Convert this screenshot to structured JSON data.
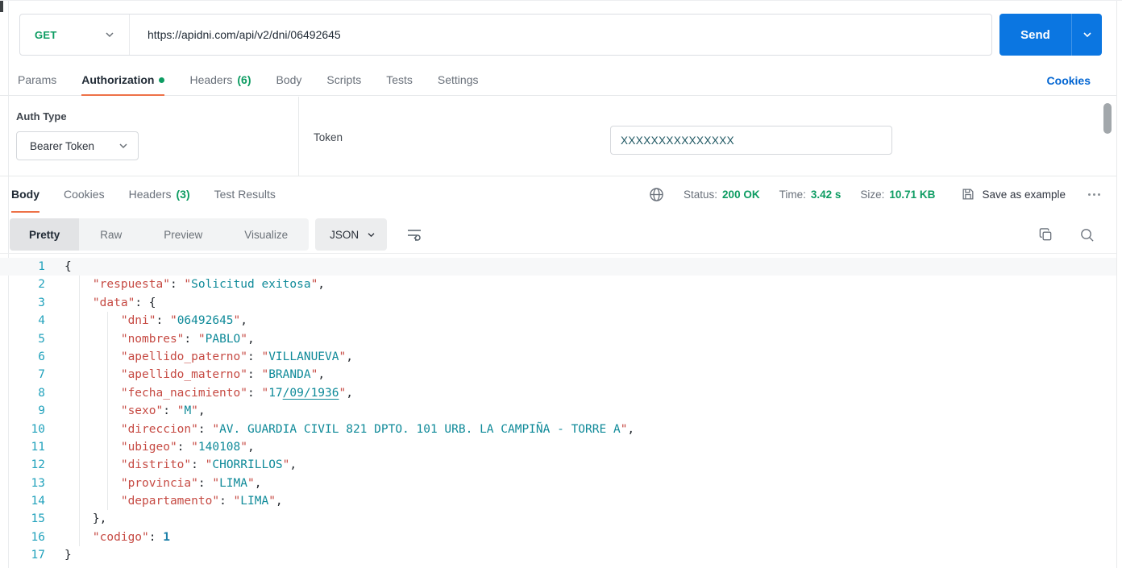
{
  "request": {
    "method": "GET",
    "url": "https://apidni.com/api/v2/dni/06492645",
    "send_label": "Send"
  },
  "request_tabs": {
    "items": [
      {
        "label": "Params"
      },
      {
        "label": "Authorization",
        "active": true,
        "dot": true
      },
      {
        "label": "Headers",
        "count": "(6)"
      },
      {
        "label": "Body"
      },
      {
        "label": "Scripts"
      },
      {
        "label": "Tests"
      },
      {
        "label": "Settings"
      }
    ],
    "cookies_link": "Cookies"
  },
  "auth": {
    "type_label": "Auth Type",
    "type_value": "Bearer Token",
    "token_label": "Token",
    "token_value": "XXXXXXXXXXXXXXX"
  },
  "response": {
    "tabs": [
      {
        "label": "Body",
        "active": true
      },
      {
        "label": "Cookies"
      },
      {
        "label": "Headers",
        "count": "(3)"
      },
      {
        "label": "Test Results"
      }
    ],
    "status_label": "Status:",
    "status_value": "200 OK",
    "time_label": "Time:",
    "time_value": "3.42 s",
    "size_label": "Size:",
    "size_value": "10.71 KB",
    "save_label": "Save as example"
  },
  "viewer": {
    "view_tabs": [
      {
        "label": "Pretty",
        "active": true
      },
      {
        "label": "Raw"
      },
      {
        "label": "Preview"
      },
      {
        "label": "Visualize"
      }
    ],
    "format": "JSON"
  },
  "icons": {
    "method_chevron": "chevron-down-icon",
    "send_chevron": "chevron-down-icon",
    "globe": "globe-icon",
    "save": "save-icon",
    "more": "more-ellipsis-icon",
    "wrap": "text-wrap-icon",
    "copy": "copy-icon",
    "search": "search-icon"
  },
  "colors": {
    "accent_orange": "#ED7147",
    "success_green": "#0D9C62",
    "link_blue": "#0265D2",
    "send_blue": "#0B76E1",
    "code_red": "#C64A43",
    "code_teal": "#0F8A99"
  },
  "code": {
    "lines": [
      {
        "n": 1,
        "hl": true,
        "seg": [
          {
            "t": "{",
            "c": "p"
          }
        ]
      },
      {
        "n": 2,
        "seg": [
          {
            "t": "    ",
            "c": "w"
          },
          {
            "t": "\"respuesta\"",
            "c": "k"
          },
          {
            "t": ": ",
            "c": "p"
          },
          {
            "t": "\"",
            "c": "k"
          },
          {
            "t": "Solicitud exitosa",
            "c": "s"
          },
          {
            "t": "\"",
            "c": "k"
          },
          {
            "t": ",",
            "c": "p"
          }
        ]
      },
      {
        "n": 3,
        "seg": [
          {
            "t": "    ",
            "c": "w"
          },
          {
            "t": "\"data\"",
            "c": "k"
          },
          {
            "t": ": {",
            "c": "p"
          }
        ]
      },
      {
        "n": 4,
        "seg": [
          {
            "t": "        ",
            "c": "w"
          },
          {
            "t": "\"dni\"",
            "c": "k"
          },
          {
            "t": ": ",
            "c": "p"
          },
          {
            "t": "\"",
            "c": "k"
          },
          {
            "t": "06492645",
            "c": "s"
          },
          {
            "t": "\"",
            "c": "k"
          },
          {
            "t": ",",
            "c": "p"
          }
        ]
      },
      {
        "n": 5,
        "seg": [
          {
            "t": "        ",
            "c": "w"
          },
          {
            "t": "\"nombres\"",
            "c": "k"
          },
          {
            "t": ": ",
            "c": "p"
          },
          {
            "t": "\"",
            "c": "k"
          },
          {
            "t": "PABLO",
            "c": "s"
          },
          {
            "t": "\"",
            "c": "k"
          },
          {
            "t": ",",
            "c": "p"
          }
        ]
      },
      {
        "n": 6,
        "seg": [
          {
            "t": "        ",
            "c": "w"
          },
          {
            "t": "\"apellido_paterno\"",
            "c": "k"
          },
          {
            "t": ": ",
            "c": "p"
          },
          {
            "t": "\"",
            "c": "k"
          },
          {
            "t": "VILLANUEVA",
            "c": "s"
          },
          {
            "t": "\"",
            "c": "k"
          },
          {
            "t": ",",
            "c": "p"
          }
        ]
      },
      {
        "n": 7,
        "seg": [
          {
            "t": "        ",
            "c": "w"
          },
          {
            "t": "\"apellido_materno\"",
            "c": "k"
          },
          {
            "t": ": ",
            "c": "p"
          },
          {
            "t": "\"",
            "c": "k"
          },
          {
            "t": "BRANDA",
            "c": "s"
          },
          {
            "t": "\"",
            "c": "k"
          },
          {
            "t": ",",
            "c": "p"
          }
        ]
      },
      {
        "n": 8,
        "seg": [
          {
            "t": "        ",
            "c": "w"
          },
          {
            "t": "\"fecha_nacimiento\"",
            "c": "k"
          },
          {
            "t": ": ",
            "c": "p"
          },
          {
            "t": "\"",
            "c": "k"
          },
          {
            "t": "17",
            "c": "s"
          },
          {
            "t": "/09/1936",
            "c": "u"
          },
          {
            "t": "\"",
            "c": "k"
          },
          {
            "t": ",",
            "c": "p"
          }
        ]
      },
      {
        "n": 9,
        "seg": [
          {
            "t": "        ",
            "c": "w"
          },
          {
            "t": "\"sexo\"",
            "c": "k"
          },
          {
            "t": ": ",
            "c": "p"
          },
          {
            "t": "\"",
            "c": "k"
          },
          {
            "t": "M",
            "c": "s"
          },
          {
            "t": "\"",
            "c": "k"
          },
          {
            "t": ",",
            "c": "p"
          }
        ]
      },
      {
        "n": 10,
        "seg": [
          {
            "t": "        ",
            "c": "w"
          },
          {
            "t": "\"direccion\"",
            "c": "k"
          },
          {
            "t": ": ",
            "c": "p"
          },
          {
            "t": "\"",
            "c": "k"
          },
          {
            "t": "AV. GUARDIA CIVIL 821 DPTO. 101 URB. LA CAMPIÑA - TORRE A",
            "c": "s"
          },
          {
            "t": "\"",
            "c": "k"
          },
          {
            "t": ",",
            "c": "p"
          }
        ]
      },
      {
        "n": 11,
        "seg": [
          {
            "t": "        ",
            "c": "w"
          },
          {
            "t": "\"ubigeo\"",
            "c": "k"
          },
          {
            "t": ": ",
            "c": "p"
          },
          {
            "t": "\"",
            "c": "k"
          },
          {
            "t": "140108",
            "c": "s"
          },
          {
            "t": "\"",
            "c": "k"
          },
          {
            "t": ",",
            "c": "p"
          }
        ]
      },
      {
        "n": 12,
        "seg": [
          {
            "t": "        ",
            "c": "w"
          },
          {
            "t": "\"distrito\"",
            "c": "k"
          },
          {
            "t": ": ",
            "c": "p"
          },
          {
            "t": "\"",
            "c": "k"
          },
          {
            "t": "CHORRILLOS",
            "c": "s"
          },
          {
            "t": "\"",
            "c": "k"
          },
          {
            "t": ",",
            "c": "p"
          }
        ]
      },
      {
        "n": 13,
        "seg": [
          {
            "t": "        ",
            "c": "w"
          },
          {
            "t": "\"provincia\"",
            "c": "k"
          },
          {
            "t": ": ",
            "c": "p"
          },
          {
            "t": "\"",
            "c": "k"
          },
          {
            "t": "LIMA",
            "c": "s"
          },
          {
            "t": "\"",
            "c": "k"
          },
          {
            "t": ",",
            "c": "p"
          }
        ]
      },
      {
        "n": 14,
        "seg": [
          {
            "t": "        ",
            "c": "w"
          },
          {
            "t": "\"departamento\"",
            "c": "k"
          },
          {
            "t": ": ",
            "c": "p"
          },
          {
            "t": "\"",
            "c": "k"
          },
          {
            "t": "LIMA",
            "c": "s"
          },
          {
            "t": "\"",
            "c": "k"
          },
          {
            "t": ",",
            "c": "p"
          }
        ]
      },
      {
        "n": 15,
        "seg": [
          {
            "t": "    ",
            "c": "w"
          },
          {
            "t": "},",
            "c": "p"
          }
        ]
      },
      {
        "n": 16,
        "seg": [
          {
            "t": "    ",
            "c": "w"
          },
          {
            "t": "\"codigo\"",
            "c": "k"
          },
          {
            "t": ": ",
            "c": "p"
          },
          {
            "t": "1",
            "c": "n"
          }
        ]
      },
      {
        "n": 17,
        "seg": [
          {
            "t": "}",
            "c": "p"
          }
        ]
      }
    ]
  }
}
